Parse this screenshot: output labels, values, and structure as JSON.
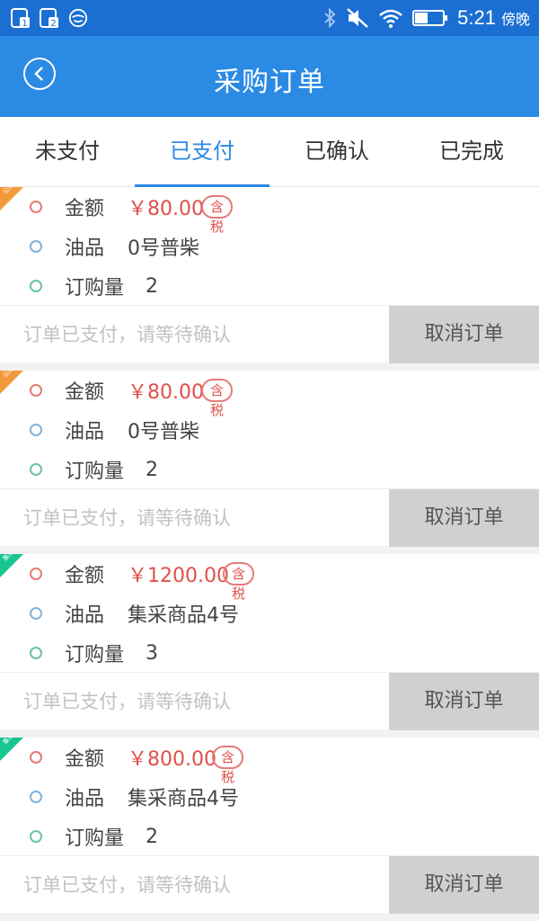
{
  "status_bar": {
    "time": "5:21",
    "time_suffix": "傍晚",
    "icons": [
      "notification-1-icon",
      "notification-2-icon",
      "mask-app-icon",
      "bluetooth-icon",
      "mute-icon",
      "wifi-icon",
      "battery-icon"
    ]
  },
  "header": {
    "title": "采购订单",
    "back_icon": "back-circle-icon"
  },
  "tabs": [
    {
      "label": "未支付",
      "active": false
    },
    {
      "label": "已支付",
      "active": true
    },
    {
      "label": "已确认",
      "active": false
    },
    {
      "label": "已完成",
      "active": false
    }
  ],
  "labels": {
    "amount": "金额",
    "oil": "油品",
    "quantity": "订购量",
    "tax": "含税",
    "status_text": "订单已支付，请等待确认",
    "cancel": "取消订单"
  },
  "orders": [
    {
      "price": "￥80.00",
      "oil": "0号普柴",
      "quantity": "2",
      "ribbon": "orange",
      "ribbon_label": "公采"
    },
    {
      "price": "￥80.00",
      "oil": "0号普柴",
      "quantity": "2",
      "ribbon": "orange",
      "ribbon_label": "公采"
    },
    {
      "price": "￥1200.00",
      "oil": "集采商品4号",
      "quantity": "3",
      "ribbon": "green",
      "ribbon_label": "集采"
    },
    {
      "price": "￥800.00",
      "oil": "集采商品4号",
      "quantity": "2",
      "ribbon": "green",
      "ribbon_label": "集采"
    }
  ],
  "colors": {
    "header_bg": "#2b8ae4",
    "status_bg": "#1b6fd3",
    "price": "#e0504b",
    "ribbon_orange": "#f29a3a",
    "ribbon_green": "#17c58f"
  }
}
